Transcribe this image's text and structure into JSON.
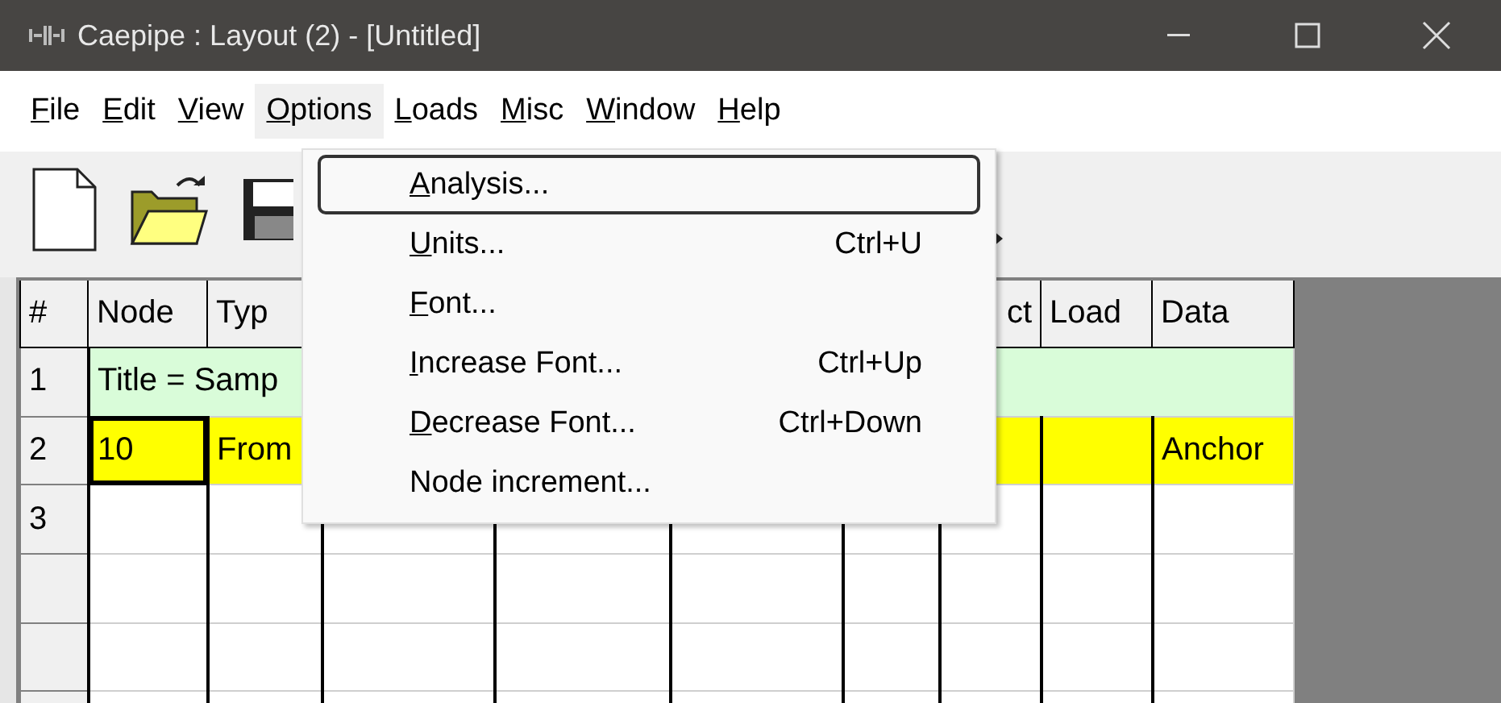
{
  "window": {
    "title": "Caepipe : Layout  (2)  -  [Untitled]"
  },
  "menu_bar": [
    {
      "label": "File",
      "underline_first": true,
      "selected": false
    },
    {
      "label": "Edit",
      "underline_first": true,
      "selected": false
    },
    {
      "label": "View",
      "underline_first": true,
      "selected": false
    },
    {
      "label": "Options",
      "underline_first": true,
      "selected": true
    },
    {
      "label": "Loads",
      "underline_first": true,
      "selected": false
    },
    {
      "label": "Misc",
      "underline_first": true,
      "selected": false
    },
    {
      "label": "Window",
      "underline_first": true,
      "selected": false
    },
    {
      "label": "Help",
      "underline_first": true,
      "selected": false
    }
  ],
  "options_menu": [
    {
      "label": "Analysis...",
      "underline_first": true,
      "selected": true
    },
    {
      "label": "Units...",
      "underline_first": true,
      "shortcut": "Ctrl+U",
      "selected": false
    },
    {
      "label": "Font...",
      "underline_first": true,
      "selected": false
    },
    {
      "label": "Increase Font...",
      "underline_first": true,
      "shortcut": "Ctrl+Up",
      "selected": false
    },
    {
      "label": "Decrease Font...",
      "underline_first": true,
      "shortcut": "Ctrl+Down",
      "selected": false
    },
    {
      "label": "Node increment...",
      "underline_first": false,
      "selected": false
    }
  ],
  "table": {
    "columns": [
      {
        "header": "#"
      },
      {
        "header": "Node"
      },
      {
        "header": "Typ"
      },
      {},
      {},
      {},
      {},
      {
        "header": "ct"
      },
      {
        "header": "Load"
      },
      {
        "header": "Data"
      }
    ],
    "rows": [
      {
        "number": "1",
        "kind": "title",
        "text": "Title = Samp"
      },
      {
        "number": "2",
        "kind": "node",
        "cells": [
          {
            "text": "10",
            "selected": true
          },
          {
            "text": "From",
            "selected": false
          },
          {},
          {},
          {},
          {},
          {},
          {
            "selected": false
          },
          {
            "text": "Anchor",
            "selected": false
          }
        ]
      },
      {
        "number": "3",
        "kind": "empty"
      },
      {
        "kind": "empty"
      },
      {
        "kind": "empty"
      },
      {
        "kind": "empty"
      }
    ]
  }
}
